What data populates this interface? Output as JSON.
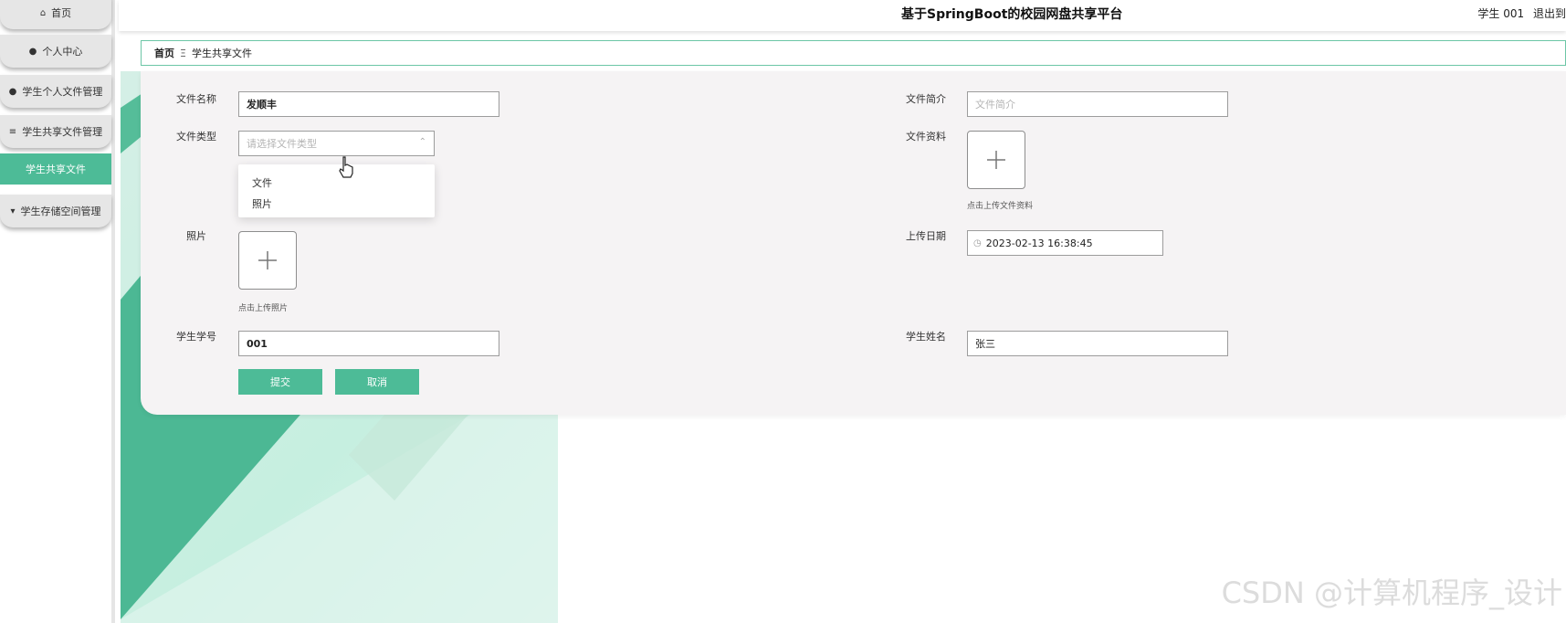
{
  "app": {
    "title": "基于SpringBoot的校园网盘共享平台",
    "user_label": "学生 001",
    "logout_label": "退出到"
  },
  "sidebar": {
    "items": [
      {
        "label": "首页",
        "icon": "home-icon"
      },
      {
        "label": "个人中心",
        "icon": "user-icon"
      },
      {
        "label": "学生个人文件管理",
        "icon": "user-icon"
      },
      {
        "label": "学生共享文件管理",
        "icon": "list-icon"
      },
      {
        "label": "学生共享文件",
        "icon": ""
      },
      {
        "label": "学生存储空间管理",
        "icon": "storage-icon"
      }
    ]
  },
  "breadcrumb": {
    "home": "首页",
    "separator": "Ξ",
    "current": "学生共享文件"
  },
  "form": {
    "file_name": {
      "label": "文件名称",
      "value": "发顺丰"
    },
    "file_intro": {
      "label": "文件简介",
      "placeholder": "文件简介"
    },
    "file_type": {
      "label": "文件类型",
      "placeholder": "请选择文件类型",
      "options": [
        "文件",
        "照片"
      ]
    },
    "file_material": {
      "label": "文件资料",
      "hint": "点击上传文件资料"
    },
    "photo": {
      "label": "照片",
      "hint": "点击上传照片"
    },
    "upload_date": {
      "label": "上传日期",
      "value": "2023-02-13 16:38:45"
    },
    "student_no": {
      "label": "学生学号",
      "value": "001"
    },
    "student_name": {
      "label": "学生姓名",
      "value": "张三"
    },
    "submit_label": "提交",
    "cancel_label": "取消"
  },
  "watermark": "CSDN @计算机程序_设计",
  "colors": {
    "accent": "#4dbb97",
    "card": "#f5f3f4"
  }
}
